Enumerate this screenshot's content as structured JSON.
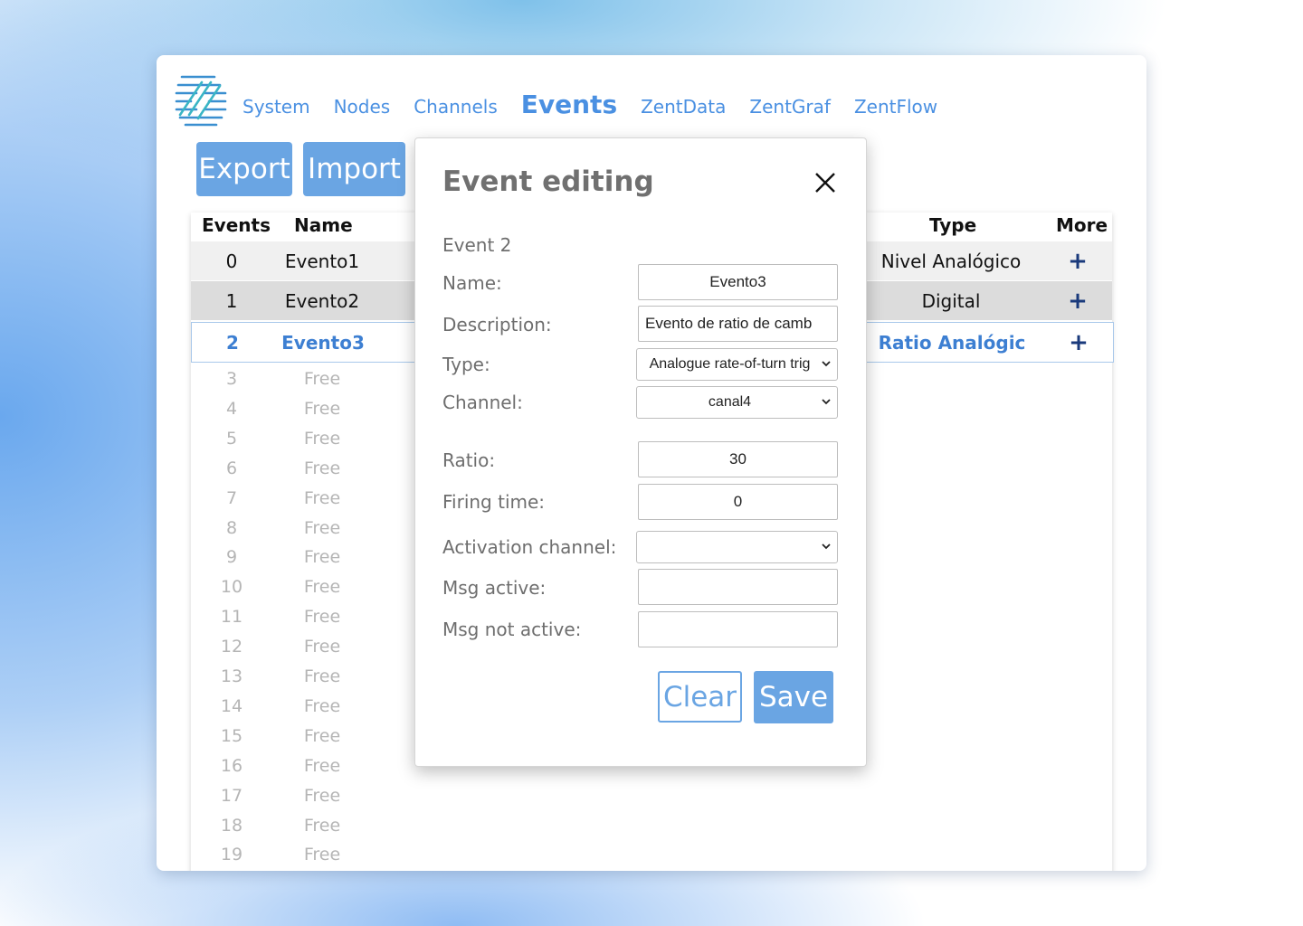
{
  "nav": {
    "items": [
      "System",
      "Nodes",
      "Channels",
      "Events",
      "ZentData",
      "ZentGraf",
      "ZentFlow"
    ],
    "active": "Events"
  },
  "toolbar": {
    "export_label": "Export",
    "import_label": "Import"
  },
  "table": {
    "headers": {
      "events": "Events",
      "name": "Name",
      "type": "Type",
      "more": "More"
    },
    "rows": [
      {
        "index": "0",
        "name": "Evento1",
        "type": "Nivel Analógico",
        "more": "+"
      },
      {
        "index": "1",
        "name": "Evento2",
        "type": "Digital",
        "more": "+"
      },
      {
        "index": "2",
        "name": "Evento3",
        "type": "Ratio Analógic",
        "more": "+"
      }
    ],
    "free_rows": [
      {
        "index": "3",
        "name": "Free"
      },
      {
        "index": "4",
        "name": "Free"
      },
      {
        "index": "5",
        "name": "Free"
      },
      {
        "index": "6",
        "name": "Free"
      },
      {
        "index": "7",
        "name": "Free"
      },
      {
        "index": "8",
        "name": "Free"
      },
      {
        "index": "9",
        "name": "Free"
      },
      {
        "index": "10",
        "name": "Free"
      },
      {
        "index": "11",
        "name": "Free"
      },
      {
        "index": "12",
        "name": "Free"
      },
      {
        "index": "13",
        "name": "Free"
      },
      {
        "index": "14",
        "name": "Free"
      },
      {
        "index": "15",
        "name": "Free"
      },
      {
        "index": "16",
        "name": "Free"
      },
      {
        "index": "17",
        "name": "Free"
      },
      {
        "index": "18",
        "name": "Free"
      },
      {
        "index": "19",
        "name": "Free"
      }
    ]
  },
  "modal": {
    "title": "Event editing",
    "subtitle": "Event 2",
    "labels": {
      "name": "Name:",
      "description": "Description:",
      "type": "Type:",
      "channel": "Channel:",
      "ratio": "Ratio:",
      "firing_time": "Firing time:",
      "activation_channel": "Activation channel:",
      "msg_active": "Msg active:",
      "msg_not_active": "Msg not active:"
    },
    "values": {
      "name": "Evento3",
      "description": "Evento de ratio de camb",
      "type": "Analogue rate-of-turn trig",
      "channel": "canal4",
      "ratio": "30",
      "firing_time": "0",
      "activation_channel": "",
      "msg_active": "",
      "msg_not_active": ""
    },
    "clear_label": "Clear",
    "save_label": "Save"
  },
  "colors": {
    "accent": "#4a90e2",
    "button": "#6aa5e3",
    "selected_text": "#3d7fd2",
    "plus": "#1a3a7c"
  }
}
